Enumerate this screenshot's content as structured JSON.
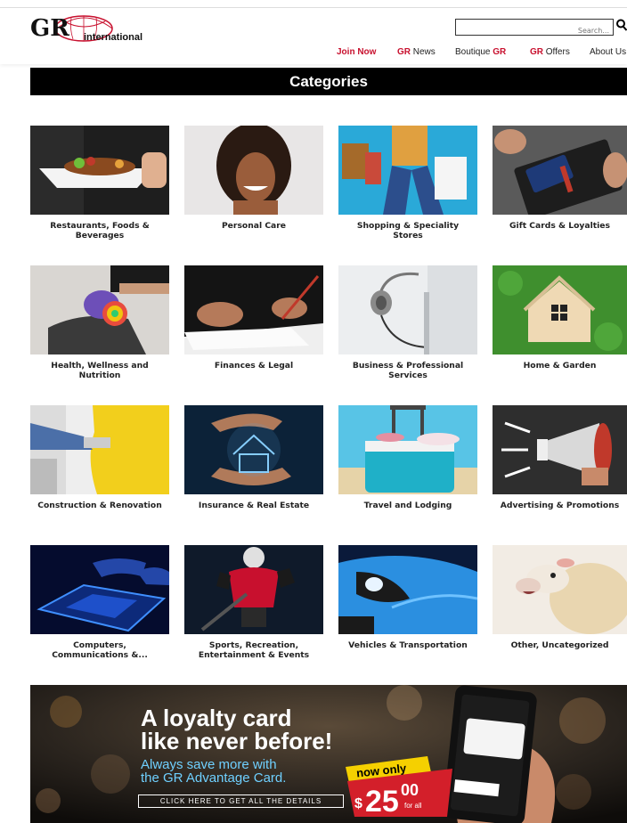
{
  "brand": {
    "logo_letters": "GR",
    "logo_text": "international"
  },
  "search": {
    "placeholder": "Search..."
  },
  "nav": [
    {
      "label": "Join Now"
    },
    {
      "prefix": "GR",
      "label": " News"
    },
    {
      "label": "Boutique ",
      "suffix": "GR"
    },
    {
      "prefix": "GR",
      "label": " Offers"
    },
    {
      "label": "About Us"
    }
  ],
  "categories_title": "Categories",
  "categories": [
    {
      "label": "Restaurants, Foods & Beverages",
      "icon": "food-plate-image"
    },
    {
      "label": "Personal Care",
      "icon": "smiling-woman-image"
    },
    {
      "label": "Shopping & Speciality Stores",
      "icon": "shopping-bags-image"
    },
    {
      "label": "Gift Cards & Loyalties",
      "icon": "wallet-card-image"
    },
    {
      "label": "Health, Wellness and Nutrition",
      "icon": "yoga-mat-image"
    },
    {
      "label": "Finances & Legal",
      "icon": "signing-document-image"
    },
    {
      "label": "Business & Professional Services",
      "icon": "headset-image"
    },
    {
      "label": "Home & Garden",
      "icon": "house-on-grass-image"
    },
    {
      "label": "Construction & Renovation",
      "icon": "painting-wall-image"
    },
    {
      "label": "Insurance & Real Estate",
      "icon": "hands-house-image"
    },
    {
      "label": "Travel and Lodging",
      "icon": "suitcase-image"
    },
    {
      "label": "Advertising & Promotions",
      "icon": "megaphone-image"
    },
    {
      "label": "Computers, Communications &...",
      "icon": "laptop-typing-image"
    },
    {
      "label": "Sports, Recreation, Entertainment & Events",
      "icon": "hockey-player-image"
    },
    {
      "label": "Vehicles & Transportation",
      "icon": "car-headlight-image"
    },
    {
      "label": "Other, Uncategorized",
      "icon": "sheep-image"
    }
  ],
  "banner": {
    "headline_1": "A loyalty card",
    "headline_2": "like never before!",
    "sub_1": "Always save more with",
    "sub_2": "the GR Advantage Card.",
    "cta": "CLICK HERE TO GET ALL THE DETAILS",
    "badge_top": "now only",
    "price_dollar": "$",
    "price_main": "25",
    "price_cents": "00",
    "price_note": "for all"
  },
  "colors": {
    "brand_red": "#c8102e",
    "black": "#000000"
  }
}
